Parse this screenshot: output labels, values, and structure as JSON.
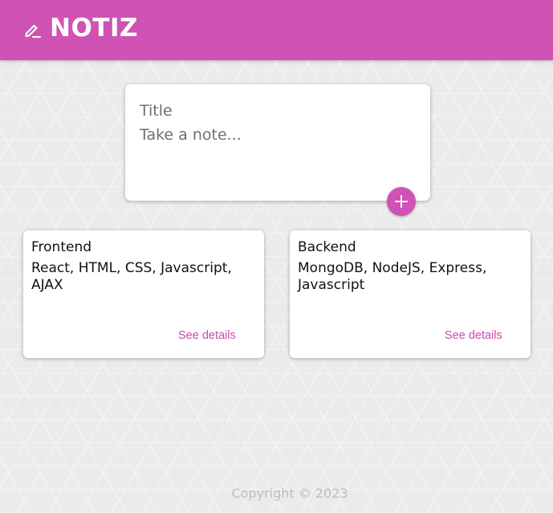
{
  "header": {
    "title": "NOTIZ",
    "icon": "pencil-icon",
    "color": "#cf52b4"
  },
  "composer": {
    "title_placeholder": "Title",
    "content_placeholder": "Take a note...",
    "add_button_icon": "plus-icon"
  },
  "notes": [
    {
      "title": "Frontend",
      "content": "React, HTML, CSS, Javascript, AJAX",
      "link": "See details"
    },
    {
      "title": "Backend",
      "content": "MongoDB, NodeJS, Express, Javascript",
      "link": "See details"
    }
  ],
  "footer": {
    "text": "Copyright © 2023"
  }
}
